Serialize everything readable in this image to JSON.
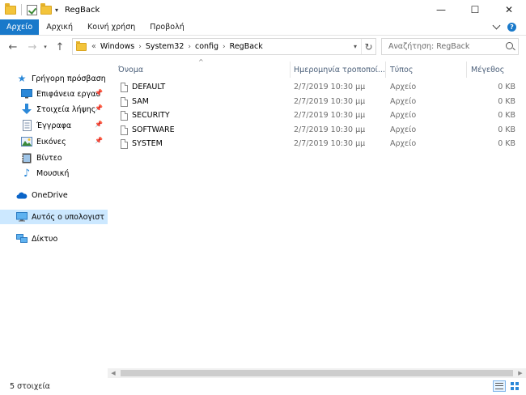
{
  "window": {
    "title": "RegBack",
    "controls": {
      "minimize": "—",
      "maximize": "☐",
      "close": "✕"
    }
  },
  "quick_access_toolbar": {
    "icons": [
      "folder-icon",
      "properties-check-icon",
      "folder-icon",
      "customize-dropdown-icon"
    ]
  },
  "ribbon": {
    "tabs": [
      "Αρχείο",
      "Αρχική",
      "Κοινή χρήση",
      "Προβολή"
    ],
    "active_tab": "Αρχείο"
  },
  "address_bar": {
    "lead": "«",
    "crumbs": [
      "Windows",
      "System32",
      "config",
      "RegBack"
    ]
  },
  "search": {
    "placeholder": "Αναζήτηση: RegBack"
  },
  "nav_pane": {
    "quick_access": "Γρήγορη πρόσβαση",
    "pinned": [
      {
        "label": "Επιφάνεια εργασ",
        "icon": "desktop-icon"
      },
      {
        "label": "Στοιχεία λήψης",
        "icon": "download-icon"
      },
      {
        "label": "Έγγραφα",
        "icon": "documents-icon"
      },
      {
        "label": "Εικόνες",
        "icon": "pictures-icon"
      }
    ],
    "libraries": [
      {
        "label": "Βίντεο",
        "icon": "videos-icon"
      },
      {
        "label": "Μουσική",
        "icon": "music-icon"
      }
    ],
    "onedrive": "OneDrive",
    "this_pc": "Αυτός ο υπολογιστ",
    "network": "Δίκτυο",
    "selected": "this_pc"
  },
  "columns": {
    "name": "Όνομα",
    "date": "Ημερομηνία τροποποί...",
    "type": "Τύπος",
    "size": "Μέγεθος"
  },
  "files": [
    {
      "name": "DEFAULT",
      "date": "2/7/2019 10:30 μμ",
      "type": "Αρχείο",
      "size": "0 KB"
    },
    {
      "name": "SAM",
      "date": "2/7/2019 10:30 μμ",
      "type": "Αρχείο",
      "size": "0 KB"
    },
    {
      "name": "SECURITY",
      "date": "2/7/2019 10:30 μμ",
      "type": "Αρχείο",
      "size": "0 KB"
    },
    {
      "name": "SOFTWARE",
      "date": "2/7/2019 10:30 μμ",
      "type": "Αρχείο",
      "size": "0 KB"
    },
    {
      "name": "SYSTEM",
      "date": "2/7/2019 10:30 μμ",
      "type": "Αρχείο",
      "size": "0 KB"
    }
  ],
  "status": {
    "count_text": "5 στοιχεία"
  },
  "colors": {
    "accent": "#1979ca",
    "selection": "#cce8ff",
    "column_header_text": "#4c607a"
  }
}
